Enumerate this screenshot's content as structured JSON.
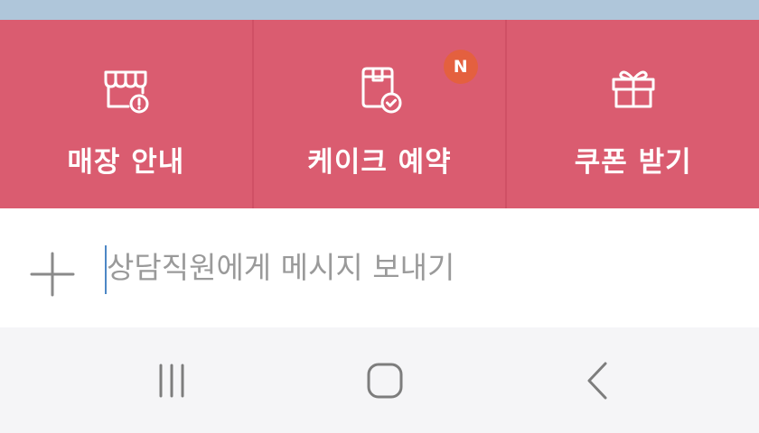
{
  "menu": {
    "items": [
      {
        "label": "매장 안내",
        "icon": "store-info-icon"
      },
      {
        "label": "케이크 예약",
        "icon": "cake-reservation-icon",
        "badge": "N"
      },
      {
        "label": "쿠폰 받기",
        "icon": "gift-icon"
      }
    ]
  },
  "chat": {
    "placeholder": "상담직원에게 메시지 보내기"
  },
  "navbar": {
    "buttons": [
      "recent-apps-icon",
      "home-icon",
      "back-icon"
    ]
  },
  "colors": {
    "menu_background": "#da5c70",
    "badge": "#e4603f",
    "status_strip": "#afc6da",
    "nav_background": "#f5f5f7",
    "caret": "#4d87c5"
  }
}
